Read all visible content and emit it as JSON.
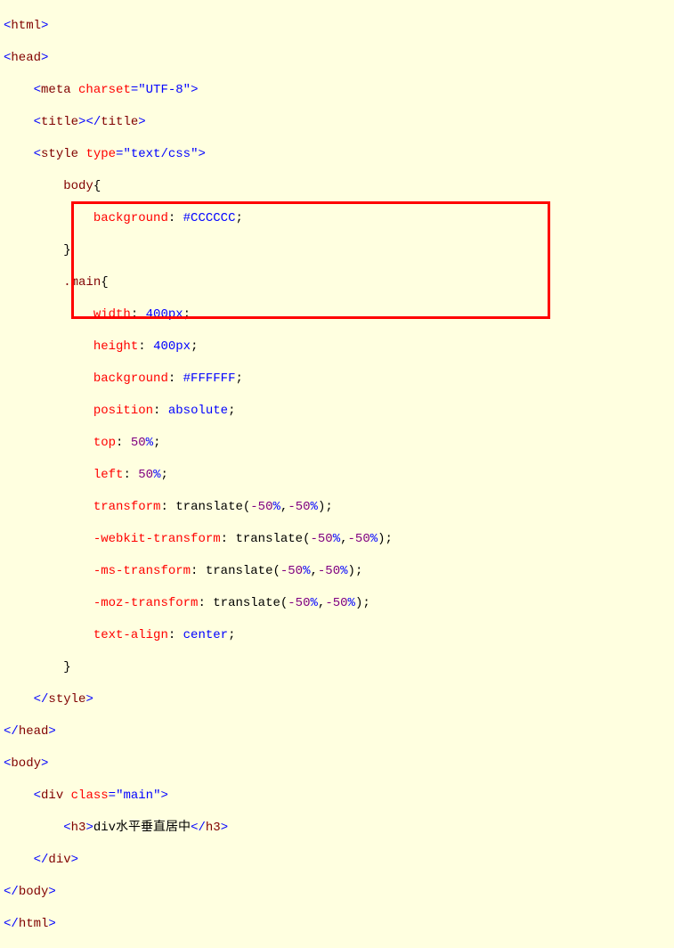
{
  "code": {
    "line1_open": "<",
    "line1_tag": "html",
    "line1_close": ">",
    "line2_open": "<",
    "line2_tag": "head",
    "line2_close": ">",
    "line3_indent": "    ",
    "line3_open": "<",
    "line3_tag": "meta",
    "line3_sp": " ",
    "line3_attr": "charset",
    "line3_eq": "=",
    "line3_val": "\"UTF-8\"",
    "line3_close": ">",
    "line4_indent": "    ",
    "line4_open": "<",
    "line4_tag": "title",
    "line4_close1": ">",
    "line4_open2": "</",
    "line4_tag2": "title",
    "line4_close2": ">",
    "line5_indent": "    ",
    "line5_open": "<",
    "line5_tag": "style",
    "line5_sp": " ",
    "line5_attr": "type",
    "line5_eq": "=",
    "line5_val": "\"text/css\"",
    "line5_close": ">",
    "line6_indent": "        ",
    "line6_sel": "body",
    "line6_brace": "{",
    "line7_indent": "            ",
    "line7_prop": "background",
    "line7_colon": ": ",
    "line7_val": "#CCCCCC",
    "line7_semi": ";",
    "line8_indent": "        ",
    "line8_brace": "}",
    "line9_indent": "        ",
    "line9_sel": ".main",
    "line9_brace": "{",
    "line10_indent": "            ",
    "line10_prop": "width",
    "line10_colon": ": ",
    "line10_val": "400px",
    "line10_semi": ";",
    "line11_indent": "            ",
    "line11_prop": "height",
    "line11_colon": ": ",
    "line11_val": "400px",
    "line11_semi": ";",
    "line12_indent": "            ",
    "line12_prop": "background",
    "line12_colon": ": ",
    "line12_val": "#FFFFFF",
    "line12_semi": ";",
    "line13_indent": "            ",
    "line13_prop": "position",
    "line13_colon": ": ",
    "line13_val": "absolute",
    "line13_semi": ";",
    "line14_indent": "            ",
    "line14_prop": "top",
    "line14_colon": ": ",
    "line14_num": "50",
    "line14_unit": "%",
    "line14_semi": ";",
    "line15_indent": "            ",
    "line15_prop": "left",
    "line15_colon": ": ",
    "line15_num": "50",
    "line15_unit": "%",
    "line15_semi": ";",
    "line16_indent": "            ",
    "line16_prop": "transform",
    "line16_colon": ": ",
    "line16_func": "translate(",
    "line16_v1": "-50",
    "line16_u1": "%",
    "line16_comma": ",",
    "line16_v2": "-50",
    "line16_u2": "%",
    "line16_paren": ")",
    "line16_semi": ";",
    "line17_indent": "            ",
    "line17_prop": "-webkit-transform",
    "line17_colon": ": ",
    "line17_func": "translate(",
    "line17_v1": "-50",
    "line17_u1": "%",
    "line17_comma": ",",
    "line17_v2": "-50",
    "line17_u2": "%",
    "line17_paren": ")",
    "line17_semi": ";",
    "line18_indent": "            ",
    "line18_prop": "-ms-transform",
    "line18_colon": ": ",
    "line18_func": "translate(",
    "line18_v1": "-50",
    "line18_u1": "%",
    "line18_comma": ",",
    "line18_v2": "-50",
    "line18_u2": "%",
    "line18_paren": ")",
    "line18_semi": ";",
    "line19_indent": "            ",
    "line19_prop": "-moz-transform",
    "line19_colon": ": ",
    "line19_func": "translate(",
    "line19_v1": "-50",
    "line19_u1": "%",
    "line19_comma": ",",
    "line19_v2": "-50",
    "line19_u2": "%",
    "line19_paren": ")",
    "line19_semi": ";",
    "line20_indent": "            ",
    "line20_prop": "text-align",
    "line20_colon": ": ",
    "line20_val": "center",
    "line20_semi": ";",
    "line21_indent": "        ",
    "line21_brace": "}",
    "line22_indent": "    ",
    "line22_open": "</",
    "line22_tag": "style",
    "line22_close": ">",
    "line23_open": "</",
    "line23_tag": "head",
    "line23_close": ">",
    "line24_open": "<",
    "line24_tag": "body",
    "line24_close": ">",
    "line25_indent": "    ",
    "line25_open": "<",
    "line25_tag": "div",
    "line25_sp": " ",
    "line25_attr": "class",
    "line25_eq": "=",
    "line25_val": "\"main\"",
    "line25_close": ">",
    "line26_indent": "        ",
    "line26_open": "<",
    "line26_tag": "h3",
    "line26_close1": ">",
    "line26_text": "div水平垂直居中",
    "line26_open2": "</",
    "line26_tag2": "h3",
    "line26_close2": ">",
    "line27_indent": "    ",
    "line27_open": "</",
    "line27_tag": "div",
    "line27_close": ">",
    "line28_open": "</",
    "line28_tag": "body",
    "line28_close": ">",
    "line29_open": "</",
    "line29_tag": "html",
    "line29_close": ">"
  }
}
